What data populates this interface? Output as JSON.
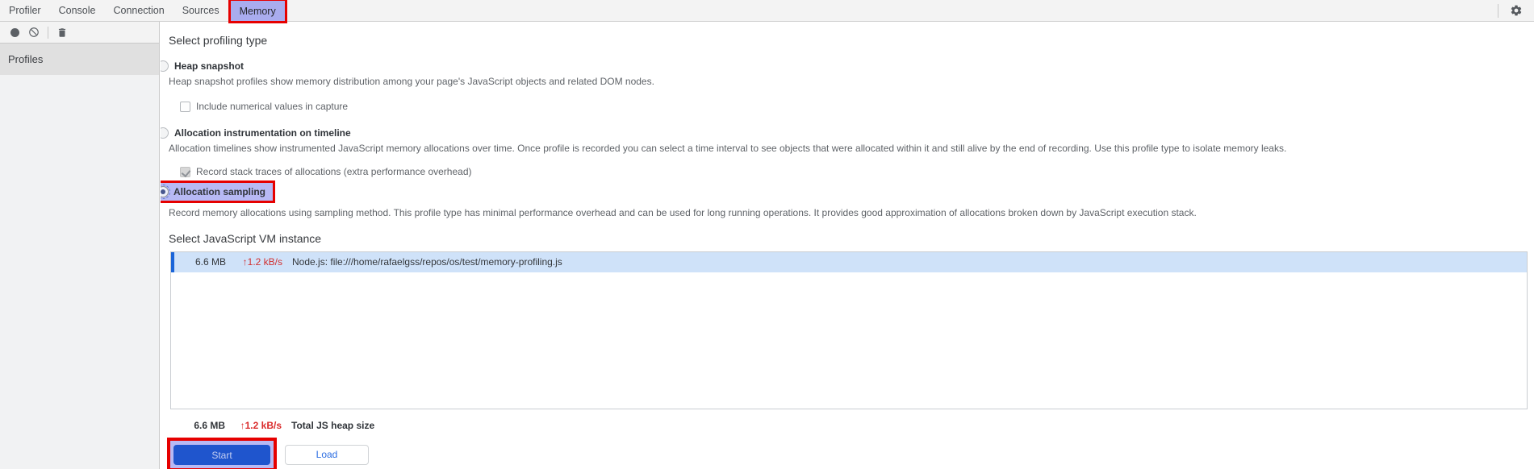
{
  "tabbar": {
    "items": [
      {
        "label": "Profiler",
        "active": false
      },
      {
        "label": "Console",
        "active": false
      },
      {
        "label": "Connection",
        "active": false
      },
      {
        "label": "Sources",
        "active": false
      },
      {
        "label": "Memory",
        "active": true
      }
    ],
    "settings_icon": "gear-icon"
  },
  "toolbar": {
    "record_icon": "record-circle-icon",
    "clear_icon": "block-icon",
    "delete_icon": "trash-icon"
  },
  "sidebar": {
    "profiles_label": "Profiles"
  },
  "profiling": {
    "heading": "Select profiling type",
    "options": [
      {
        "label": "Heap snapshot",
        "selected": false,
        "description": "Heap snapshot profiles show memory distribution among your page's JavaScript objects and related DOM nodes.",
        "checkbox": {
          "label": "Include numerical values in capture",
          "checked": false,
          "disabled": false
        }
      },
      {
        "label": "Allocation instrumentation on timeline",
        "selected": false,
        "description": "Allocation timelines show instrumented JavaScript memory allocations over time. Once profile is recorded you can select a time interval to see objects that were allocated within it and still alive by the end of recording. Use this profile type to isolate memory leaks.",
        "checkbox": {
          "label": "Record stack traces of allocations (extra performance overhead)",
          "checked": true,
          "disabled": true
        }
      },
      {
        "label": "Allocation sampling",
        "selected": true,
        "highlighted": true,
        "description": "Record memory allocations using sampling method. This profile type has minimal performance overhead and can be used for long running operations. It provides good approximation of allocations broken down by JavaScript execution stack."
      }
    ]
  },
  "vm": {
    "heading": "Select JavaScript VM instance",
    "instances": [
      {
        "size": "6.6 MB",
        "rate": "↑1.2 kB/s",
        "name": "Node.js: file:///home/rafaelgss/repos/os/test/memory-profiling.js",
        "selected": true
      }
    ],
    "total": {
      "size": "6.6 MB",
      "rate": "↑1.2 kB/s",
      "label": "Total JS heap size"
    }
  },
  "actions": {
    "start_label": "Start",
    "load_label": "Load"
  },
  "colors": {
    "annotation_red": "#e60000",
    "highlight_lavender": "#b7b9f4",
    "active_tab_bg": "#a9acee",
    "primary_button_blue": "#1f55cd",
    "selected_row_bg": "#cfe2f9",
    "selected_row_accent": "#1a64d8",
    "rate_red": "#d13030"
  }
}
